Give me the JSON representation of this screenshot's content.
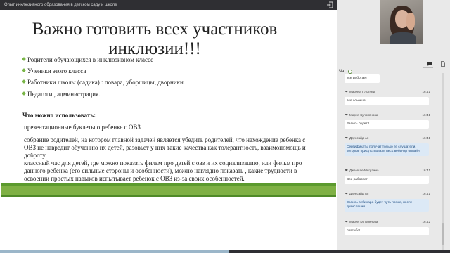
{
  "topbar": {
    "title": "Опыт инклюзивного образования в детском саду и школе"
  },
  "slide": {
    "title": "Важно готовить всех участников инклюзии!!!",
    "bullets": [
      "Родители обучающихся в инклюзивном классе",
      "Ученики этого класса",
      "Работники школы (садика) : повара, уборщицы, дворники.",
      "Педагоги , администрация."
    ],
    "heading": "Что можно использовать:",
    "paragraphs": [
      "презентационные буклеты о ребенке с ОВЗ",
      "собрание родителей, на котором главной задачей является убедить родителей, что нахождение ребенка с ОВЗ не навредит обучению их детей, разовьет у них такие качества как толерантность, взаимопомощь и доброту",
      "классный час для детей, где можно показать фильм про детей с овз и их социализацию, или фильм про данного ребенка (его сильные стороны и особенности), можно наглядно показать , какие трудности в освоении простых навыков испытывает ребенок с ОВЗ из-за своих особенностей."
    ]
  },
  "chat": {
    "label": "Чат",
    "first_partial": "все работает",
    "messages": [
      {
        "author": "Марина Плотнер",
        "time": "16:41",
        "text": "все слышно",
        "staff": false
      },
      {
        "author": "Мария Куприянова",
        "time": "16:41",
        "text": "Запись будет?",
        "staff": false
      },
      {
        "author": "Даунсайд Ап",
        "time": "16:41",
        "text": "Сертификаты получат только те слушатели, которые присутствовали весь вебинар онлайн",
        "staff": true
      },
      {
        "author": "Джамиле Мигулина",
        "time": "16:41",
        "text": "Все работает",
        "staff": false
      },
      {
        "author": "Даунсайд Ап",
        "time": "16:41",
        "text": "Запись вебинара будет чуть позже, после трансляции",
        "staff": true
      },
      {
        "author": "Мария Куприянова",
        "time": "16:42",
        "text": "спасибо!",
        "staff": false
      }
    ]
  },
  "player": {
    "progress": 0.51
  },
  "colors": {
    "accent": "#7ab648",
    "topbar": "#2f2f33",
    "staff_bubble": "#dce9f6"
  },
  "icons": [
    "exit-icon",
    "chat-icon",
    "document-icon",
    "bullet-diamond-icon",
    "graduation-cap-icon"
  ]
}
